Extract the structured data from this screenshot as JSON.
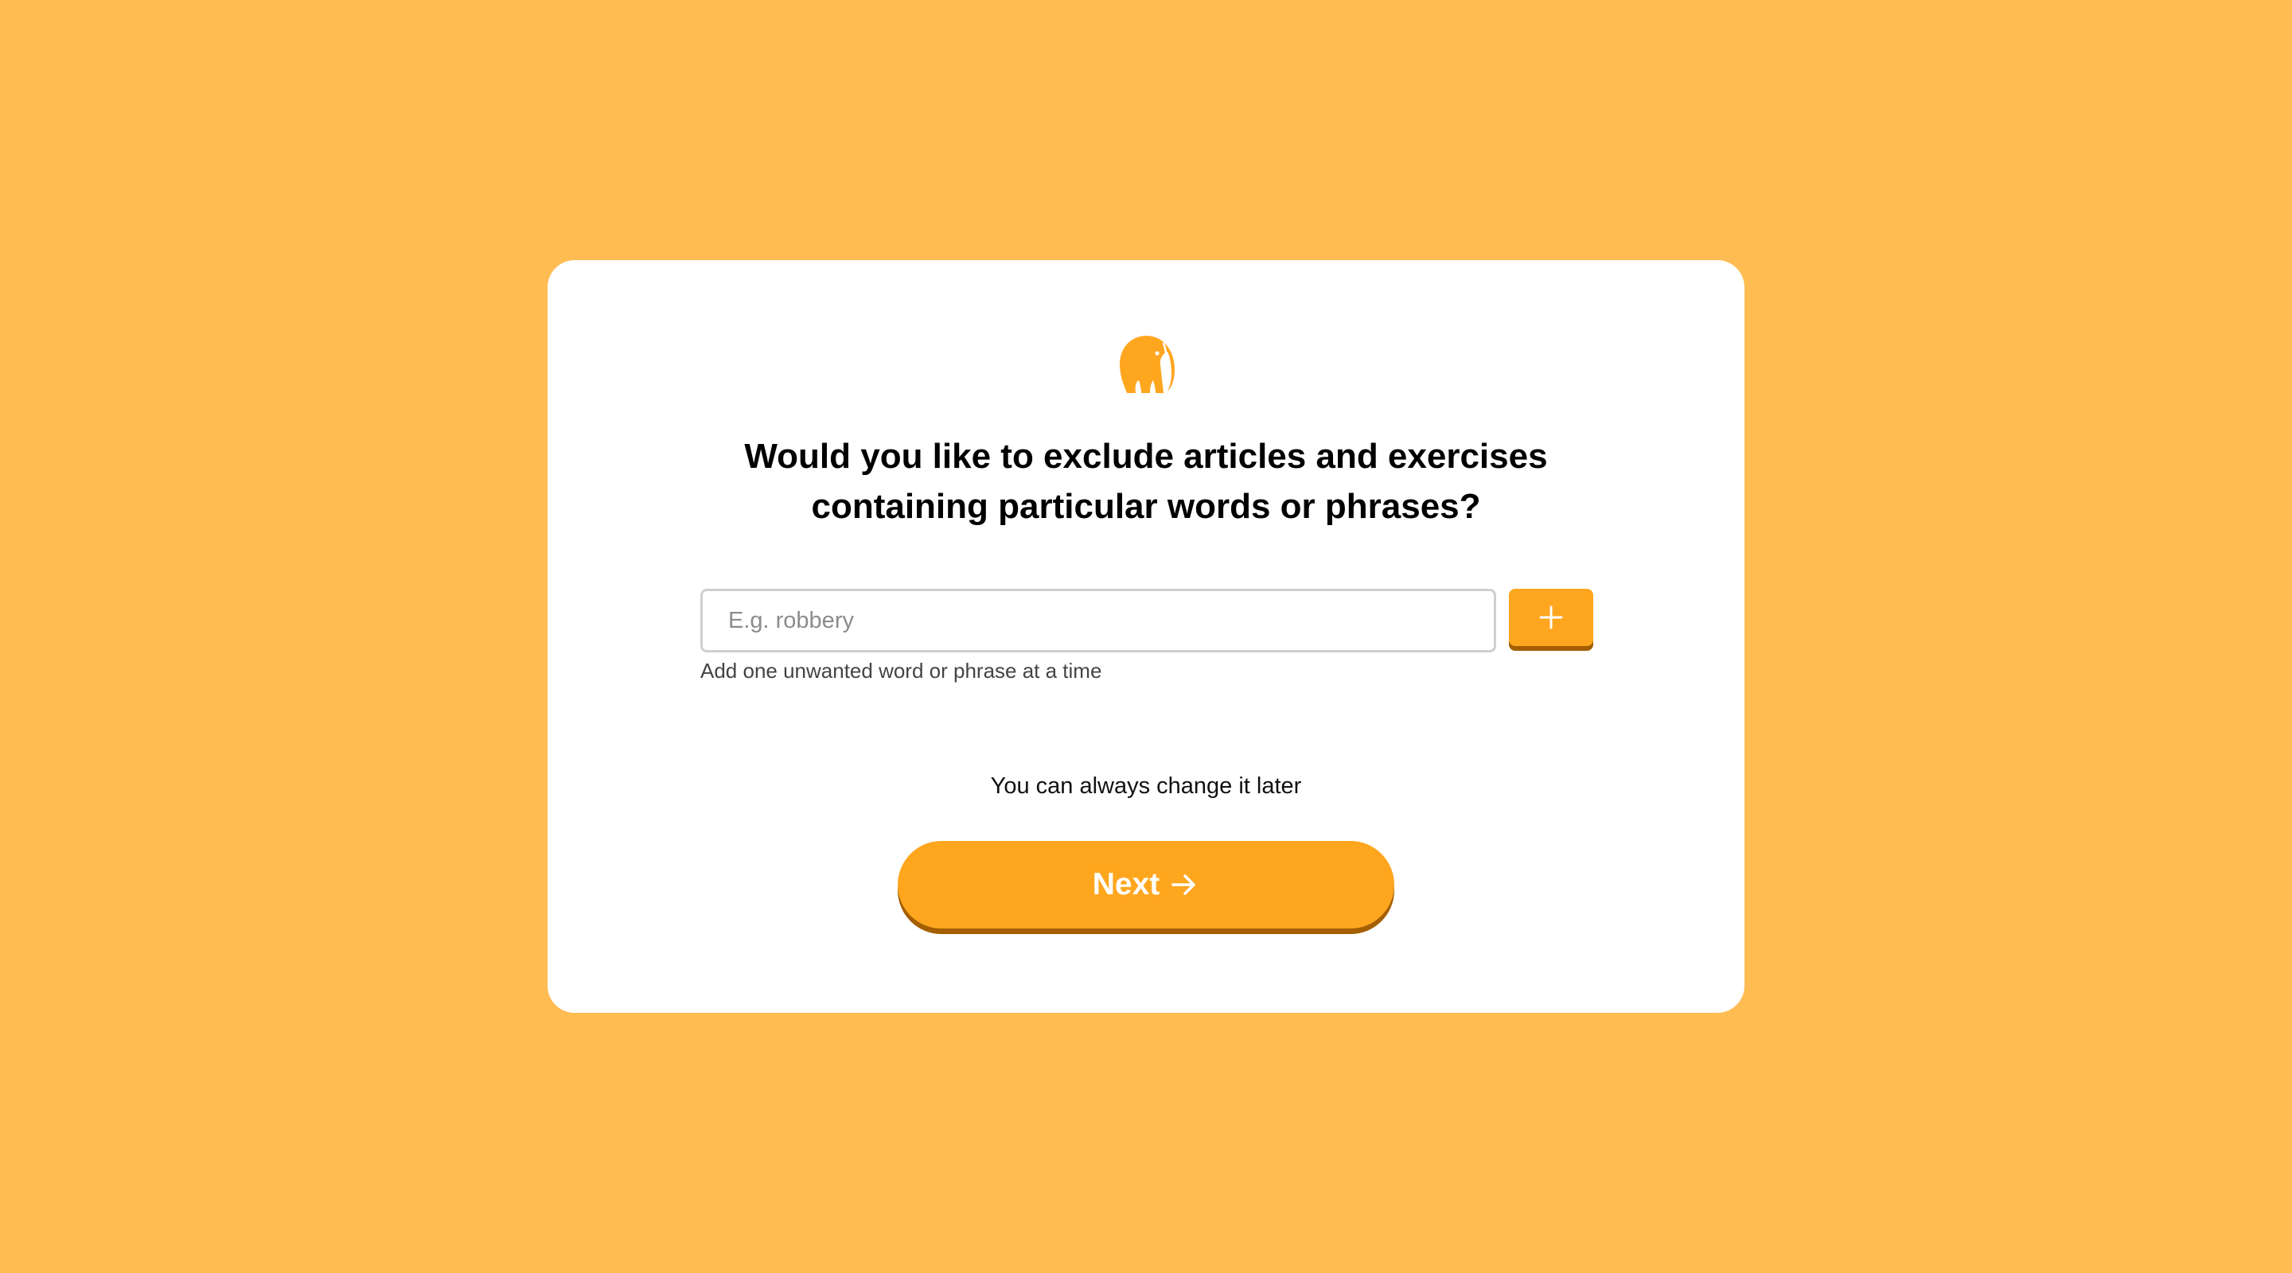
{
  "colors": {
    "background": "#FFBC52",
    "card": "#FFFFFF",
    "accent": "#FFA61F",
    "accent_shadow": "#A35F00"
  },
  "logo": {
    "icon": "elephant-icon"
  },
  "question": {
    "line1": "Would you like to exclude articles and exercises",
    "line2": "containing particular words or phrases?"
  },
  "word_input": {
    "value": "",
    "placeholder": "E.g. robbery",
    "hint": "Add one unwanted word or phrase at a time"
  },
  "add_button": {
    "icon": "plus-icon"
  },
  "footer": {
    "note": "You can always change it later",
    "next_label": "Next",
    "next_icon": "arrow-right-icon"
  }
}
